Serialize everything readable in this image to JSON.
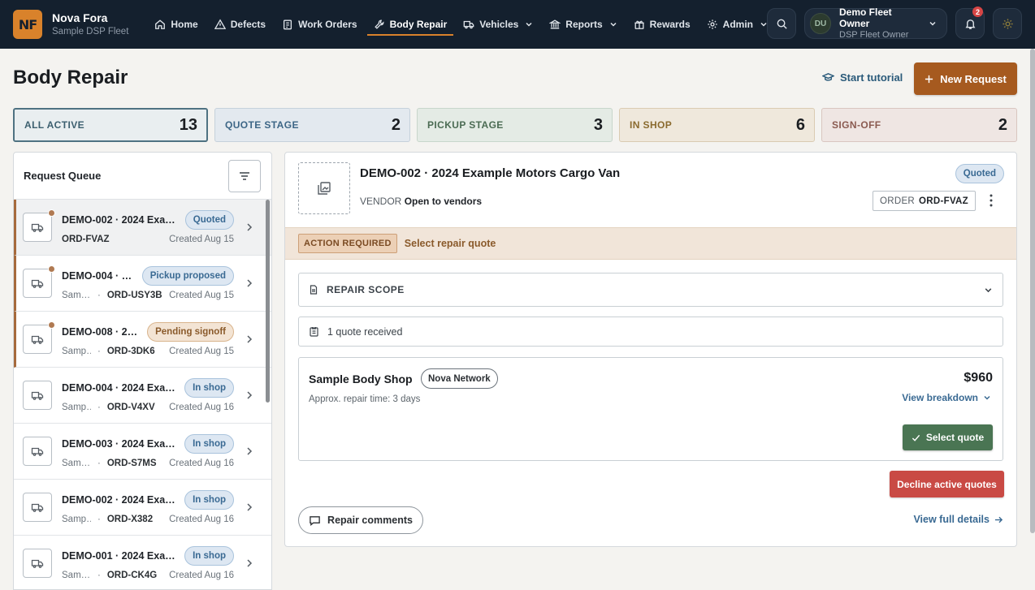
{
  "brand": {
    "logo_text": "NF",
    "name": "Nova Fora",
    "subtitle": "Sample DSP Fleet"
  },
  "nav": [
    {
      "label": "Home",
      "icon": "home-icon"
    },
    {
      "label": "Defects",
      "icon": "warning-icon"
    },
    {
      "label": "Work Orders",
      "icon": "clipboard-icon"
    },
    {
      "label": "Body Repair",
      "icon": "wrench-icon",
      "active": true
    },
    {
      "label": "Vehicles",
      "icon": "truck-icon",
      "dropdown": true
    },
    {
      "label": "Reports",
      "icon": "bank-icon",
      "dropdown": true
    },
    {
      "label": "Rewards",
      "icon": "gift-icon"
    },
    {
      "label": "Admin",
      "icon": "gear-icon",
      "dropdown": true
    }
  ],
  "user": {
    "initials": "DU",
    "name": "Demo Fleet Owner",
    "role": "DSP Fleet Owner"
  },
  "notifications": {
    "count": "2"
  },
  "page": {
    "title": "Body Repair",
    "tutorial_label": "Start tutorial",
    "new_request_label": "New Request"
  },
  "stages": [
    {
      "label": "ALL ACTIVE",
      "count": "13",
      "selected": true
    },
    {
      "label": "QUOTE STAGE",
      "count": "2"
    },
    {
      "label": "PICKUP STAGE",
      "count": "3"
    },
    {
      "label": "IN SHOP",
      "count": "6"
    },
    {
      "label": "SIGN-OFF",
      "count": "2"
    }
  ],
  "queue": {
    "title": "Request Queue",
    "items": [
      {
        "title": "DEMO-002 · 2024 Exa…",
        "shop": "",
        "order": "ORD-FVAZ",
        "created": "Created Aug 15",
        "status": "Quoted",
        "status_color": "blue",
        "attention": true,
        "selected": true
      },
      {
        "title": "DEMO-004 · …",
        "shop": "Sam…",
        "order": "ORD-USY3B",
        "created": "Created Aug 15",
        "status": "Pickup proposed",
        "status_color": "blue",
        "attention": true
      },
      {
        "title": "DEMO-008 · 2…",
        "shop": "Samp…",
        "order": "ORD-3DK6",
        "created": "Created Aug 15",
        "status": "Pending signoff",
        "status_color": "tan",
        "attention": true
      },
      {
        "title": "DEMO-004 · 2024 Exa…",
        "shop": "Samp…",
        "order": "ORD-V4XV",
        "created": "Created Aug 16",
        "status": "In shop",
        "status_color": "blue"
      },
      {
        "title": "DEMO-003 · 2024 Exa…",
        "shop": "Sam…",
        "order": "ORD-S7MS",
        "created": "Created Aug 16",
        "status": "In shop",
        "status_color": "blue"
      },
      {
        "title": "DEMO-002 · 2024 Exa…",
        "shop": "Samp…",
        "order": "ORD-X382",
        "created": "Created Aug 16",
        "status": "In shop",
        "status_color": "blue"
      },
      {
        "title": "DEMO-001 · 2024 Exa…",
        "shop": "Sam…",
        "order": "ORD-CK4G",
        "created": "Created Aug 16",
        "status": "In shop",
        "status_color": "blue"
      }
    ]
  },
  "detail": {
    "title": "DEMO-002 · 2024 Example Motors Cargo Van",
    "vendor_label": "VENDOR",
    "vendor_value": "Open to vendors",
    "status": "Quoted",
    "order_label": "ORDER",
    "order_value": "ORD-FVAZ",
    "action_tag": "ACTION REQUIRED",
    "action_text": "Select repair quote",
    "scope_label": "REPAIR SCOPE",
    "quotes_count": "1 quote received",
    "quote": {
      "shop": "Sample Body Shop",
      "network": "Nova Network",
      "repair_time": "Approx. repair time: 3 days",
      "price": "$960",
      "breakdown_label": "View breakdown",
      "select_label": "Select quote"
    },
    "decline_label": "Decline active quotes",
    "comments_label": "Repair comments",
    "full_details_label": "View full details"
  },
  "colors": {
    "nav_bg": "#14202e",
    "accent": "#d9822b",
    "primary_button": "#a65a1f",
    "select_button": "#4a7553",
    "decline_button": "#c94a44",
    "link": "#3a6a93"
  }
}
